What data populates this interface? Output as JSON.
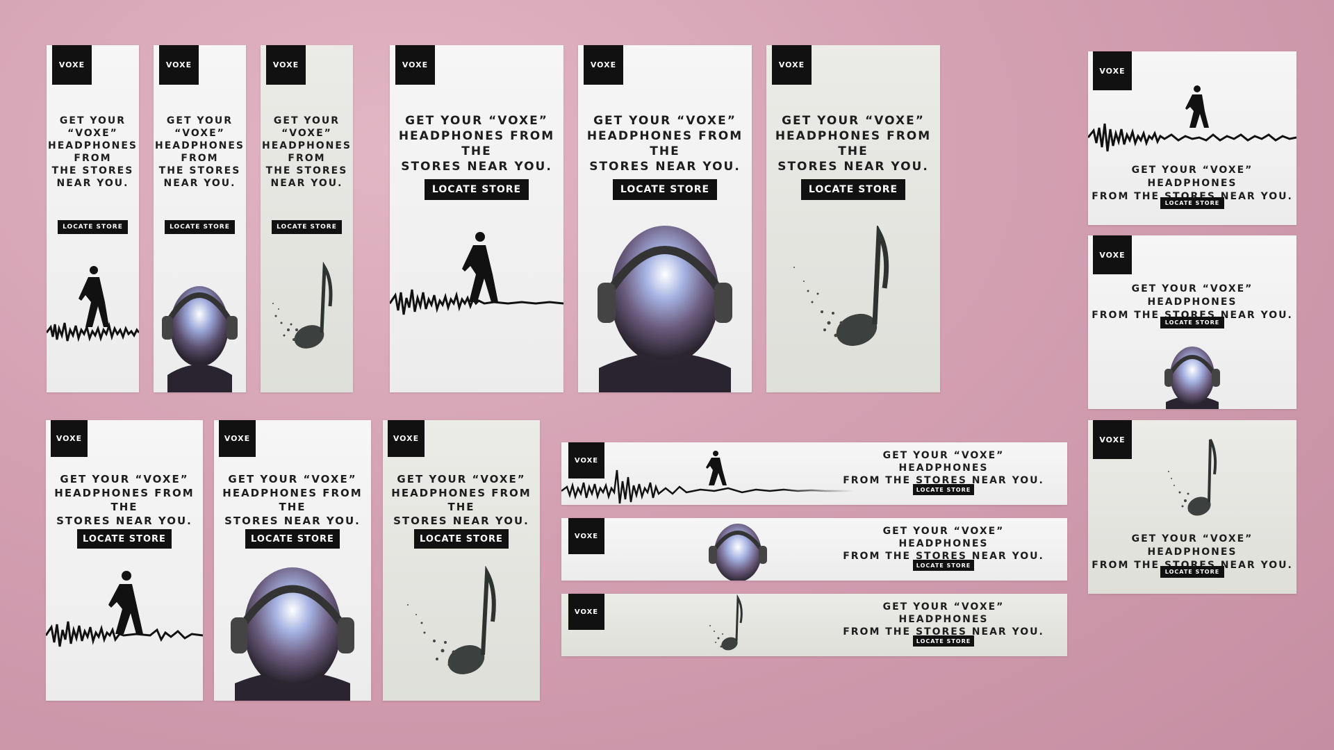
{
  "brand": "VOXE",
  "headline_short": "GET YOUR\n“VOXE”\nHEADPHONES\nFROM\nTHE STORES\nNEAR YOU.",
  "headline_medium": "GET YOUR “VOXE”\nHEADPHONES FROM THE\nSTORES NEAR YOU.",
  "headline_wide": "GET YOUR “VOXE” HEADPHONES\nFROM THE STORES NEAR YOU.",
  "cta": "LOCATE STORE",
  "icons": [
    "walker-waveform-icon",
    "headphone-head-icon",
    "music-note-icon"
  ],
  "colors": {
    "background": "#d3a0b2",
    "logo": "#111111",
    "button": "#111111"
  }
}
